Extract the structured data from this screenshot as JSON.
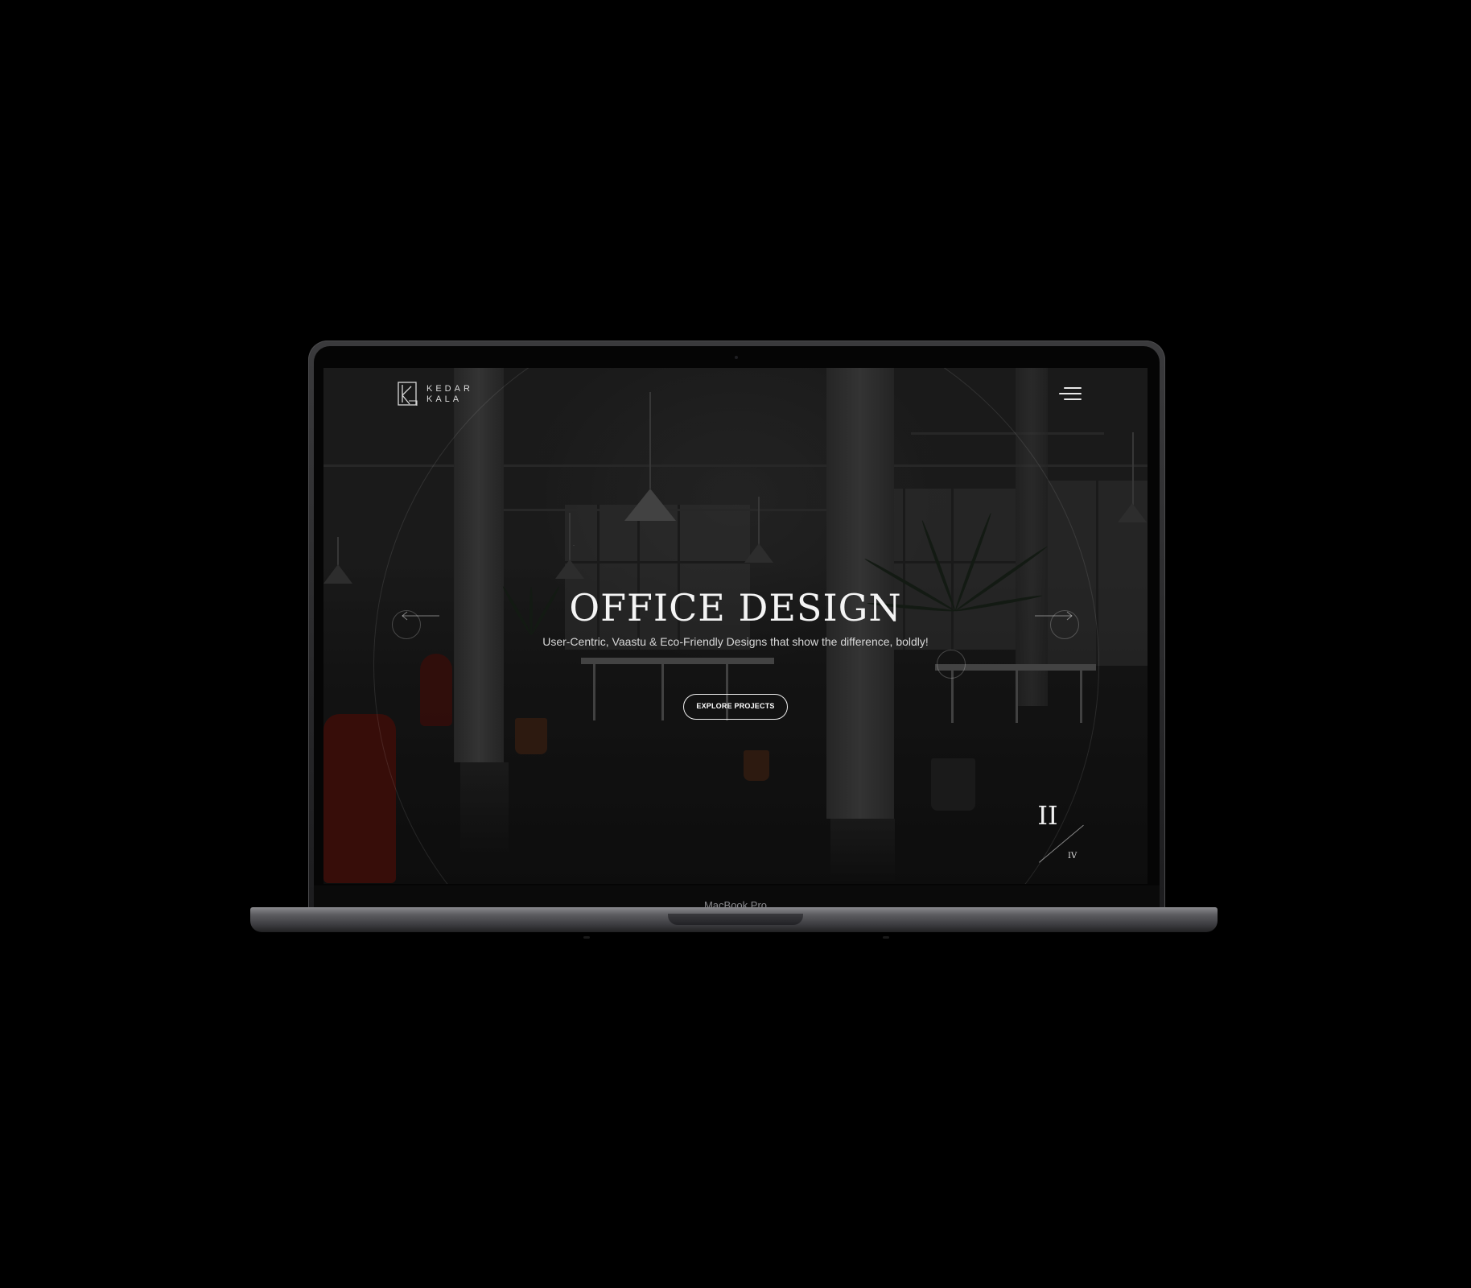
{
  "device": {
    "model_label": "MacBook Pro"
  },
  "site": {
    "brand": {
      "line1": "KEDAR",
      "line2": "KALA"
    },
    "hero": {
      "title": "OFFICE DESIGN",
      "subtitle": "User-Centric, Vaastu & Eco-Friendly Designs that show the difference, boldly!",
      "cta_label": "EXPLORE PROJECTS"
    },
    "slider": {
      "current": "II",
      "total": "IV"
    },
    "icons": {
      "menu": "hamburger-menu-icon",
      "prev": "arrow-left-icon",
      "next": "arrow-right-icon",
      "logo": "kedar-kala-logo-mark"
    }
  }
}
